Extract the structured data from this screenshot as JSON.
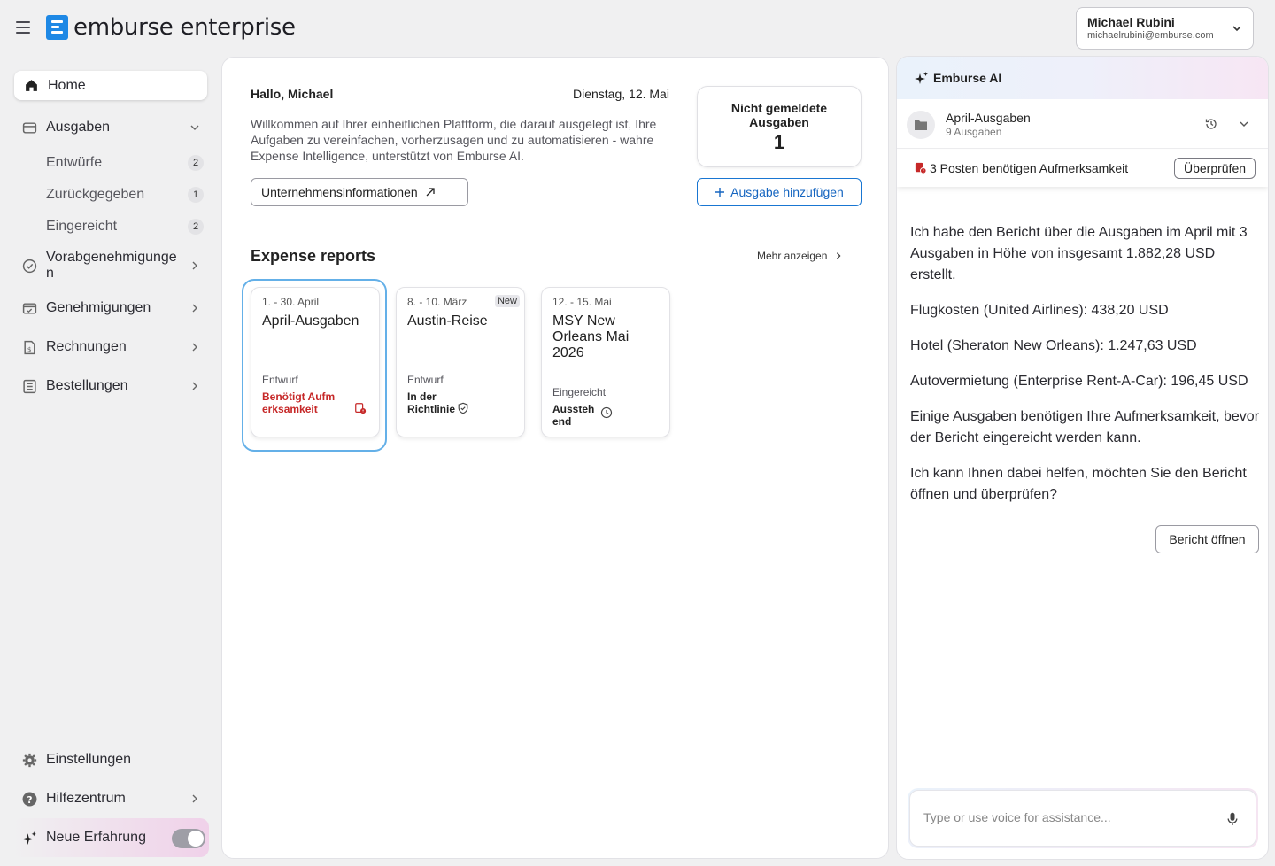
{
  "header": {
    "logo_text": "emburse enterprise",
    "user_name": "Michael Rubini",
    "user_email": "michaelrubini@emburse.com"
  },
  "sidebar": {
    "items": [
      {
        "label": "Home"
      },
      {
        "label": "Ausgaben"
      },
      {
        "label": "Entwürfe",
        "count": "2"
      },
      {
        "label": "Zurückgegeben",
        "count": "1"
      },
      {
        "label": "Eingereicht",
        "count": "2"
      },
      {
        "label": "Vorabgenehmigungen"
      },
      {
        "label": "Genehmigungen"
      },
      {
        "label": "Rechnungen"
      },
      {
        "label": "Bestellungen"
      }
    ],
    "bottom": [
      {
        "label": "Einstellungen"
      },
      {
        "label": "Hilfezentrum"
      },
      {
        "label": "Neue Erfahrung",
        "toggle_on": true
      }
    ]
  },
  "main": {
    "greeting": "Hallo, Michael",
    "date": "Dienstag, 12. Mai",
    "intro": "Willkommen auf Ihrer einheitlichen Plattform, die darauf ausgelegt ist, Ihre Aufgaben zu vereinfachen, vorherzusagen und zu automatisieren - wahre Expense Intelligence, unterstützt von Emburse AI.",
    "org_button": "Unternehmensinformationen",
    "unreported_label": "Nicht gemeldete Ausgaben",
    "unreported_count": "1",
    "add_button": "Ausgabe hinzufügen",
    "section_title": "Expense reports",
    "more_link": "Mehr anzeigen",
    "reports": [
      {
        "date": "1. - 30. April",
        "title": "April-Ausgaben",
        "status": "Entwurf",
        "sub": "Benötigt Aufmerksamkeit",
        "selected": true
      },
      {
        "date": "8. - 10. März",
        "badge": "New",
        "title": "Austin-Reise",
        "status": "Entwurf",
        "sub": "In der Richtlinie"
      },
      {
        "date": "12. - 15. Mai",
        "title": "MSY New Orleans Mai 2026",
        "status": "Eingereicht",
        "sub": "Ausstehend"
      }
    ]
  },
  "ai": {
    "title": "Emburse AI",
    "report_title": "April-Ausgaben",
    "report_sub": "9 Ausgaben",
    "alert_text": "3 Posten benötigen Aufmerksamkeit",
    "review_button": "Überprüfen",
    "messages": [
      "Ich habe den Bericht über die Ausgaben im April mit 3 Ausgaben in Höhe von insgesamt 1.882,28 USD erstellt.",
      "Flugkosten (United Airlines): 438,20 USD",
      "Hotel (Sheraton New Orleans): 1.247,63 USD",
      "Autovermietung (Enterprise Rent-A-Car): 196,45 USD",
      "Einige Ausgaben benötigen Ihre Aufmerksamkeit, bevor der Bericht eingereicht werden kann.",
      "Ich kann Ihnen dabei helfen, möchten Sie den Bericht öffnen und überprüfen?"
    ],
    "open_button": "Bericht öffnen",
    "input_placeholder": "Type or use voice for assistance..."
  },
  "colors": {
    "accent": "#1e88e5",
    "alert": "#c62828",
    "selection": "#64b0e8"
  }
}
